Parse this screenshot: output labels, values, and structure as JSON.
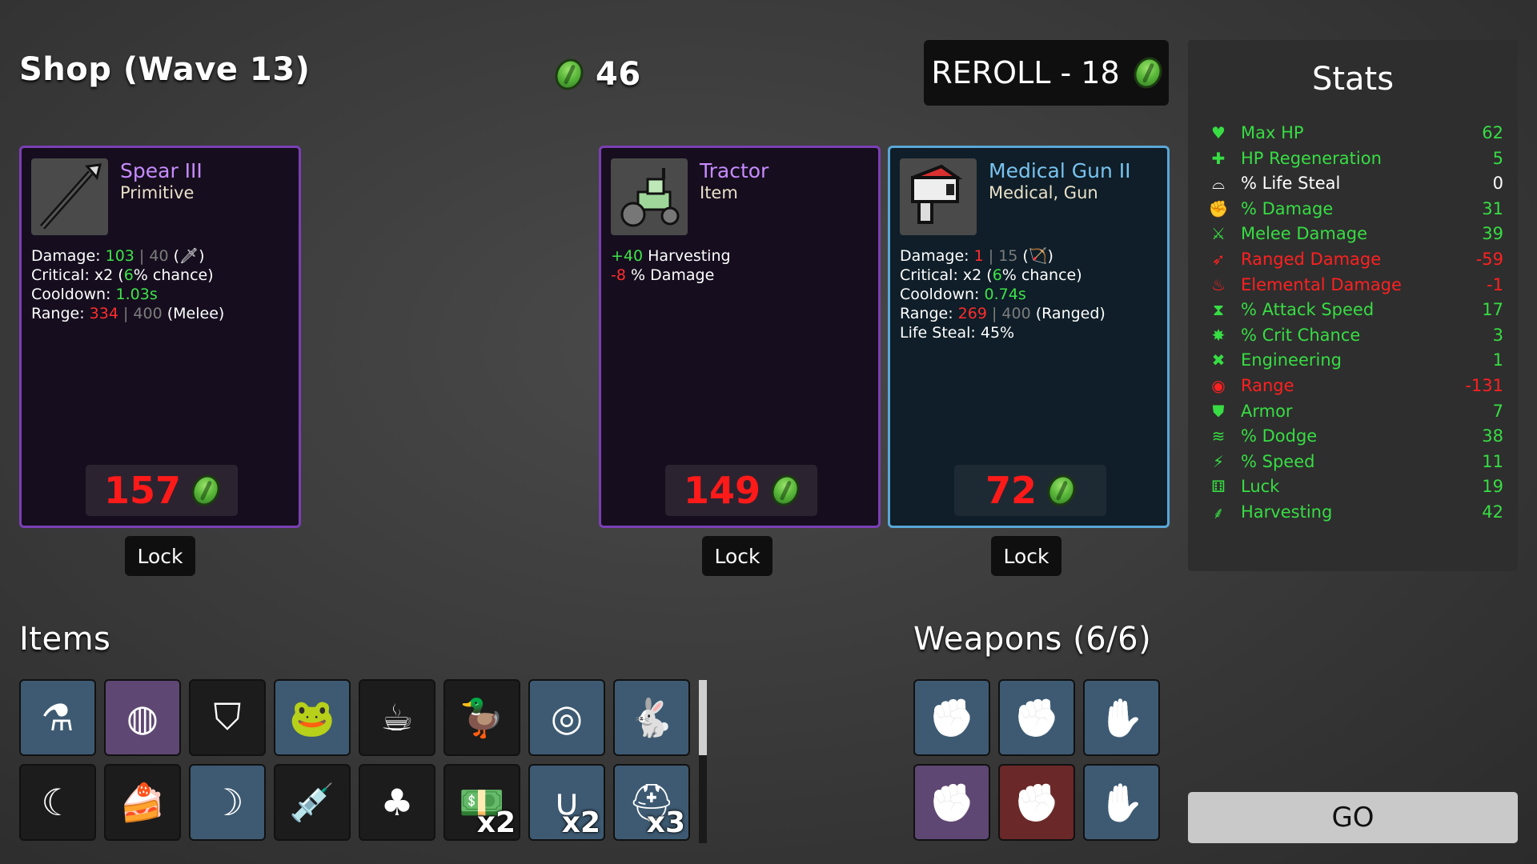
{
  "header": {
    "shop_title": "Shop (Wave 13)",
    "materials": "46",
    "reroll_label": "REROLL - 18"
  },
  "shop": [
    {
      "name": "Spear III",
      "tags": "Primitive",
      "icon": "spear-icon",
      "lines": [
        {
          "label": "Damage: ",
          "parts": [
            [
              "g",
              "103"
            ],
            [
              "grey",
              " | 40 "
            ],
            [
              "w",
              "(🗡)"
            ]
          ]
        },
        {
          "label": "Critical: ",
          "parts": [
            [
              "w",
              "x2 ("
            ],
            [
              "g",
              "6"
            ],
            [
              "w",
              "% chance)"
            ]
          ]
        },
        {
          "label": "Cooldown: ",
          "parts": [
            [
              "g",
              "1.03s"
            ]
          ]
        },
        {
          "label": "Range: ",
          "parts": [
            [
              "r",
              "334"
            ],
            [
              "grey",
              " | 400 "
            ],
            [
              "w",
              "(Melee)"
            ]
          ]
        }
      ],
      "price": "157",
      "lock": "Lock"
    },
    {
      "name": "Tractor",
      "tags": "Item",
      "icon": "tractor-icon",
      "lines": [
        {
          "label": "",
          "parts": [
            [
              "g",
              "+40"
            ],
            [
              "w",
              " Harvesting"
            ]
          ]
        },
        {
          "label": "",
          "parts": [
            [
              "r",
              "-8"
            ],
            [
              "w",
              " % Damage"
            ]
          ]
        }
      ],
      "price": "149",
      "lock": "Lock"
    },
    {
      "name": "Medical Gun II",
      "tags": "Medical, Gun",
      "icon": "medical-gun-icon",
      "lines": [
        {
          "label": "Damage: ",
          "parts": [
            [
              "r",
              "1"
            ],
            [
              "grey",
              " | 15 "
            ],
            [
              "w",
              "(🏹)"
            ]
          ]
        },
        {
          "label": "Critical: ",
          "parts": [
            [
              "w",
              "x2 ("
            ],
            [
              "g",
              "6"
            ],
            [
              "w",
              "% chance)"
            ]
          ]
        },
        {
          "label": "Cooldown: ",
          "parts": [
            [
              "g",
              "0.74s"
            ]
          ]
        },
        {
          "label": "Range: ",
          "parts": [
            [
              "r",
              "269"
            ],
            [
              "grey",
              " | 400 "
            ],
            [
              "w",
              "(Ranged)"
            ]
          ]
        },
        {
          "label": "Life Steal: ",
          "parts": [
            [
              "w",
              "45%"
            ]
          ]
        }
      ],
      "price": "72",
      "lock": "Lock"
    }
  ],
  "stats": {
    "title": "Stats",
    "rows": [
      {
        "label": "Max HP",
        "value": "62",
        "color": "green",
        "icon": "heart-icon",
        "glyph": "♥"
      },
      {
        "label": "HP Regeneration",
        "value": "5",
        "color": "green",
        "icon": "heart-plus-icon",
        "glyph": "✚"
      },
      {
        "label": "% Life Steal",
        "value": "0",
        "color": "white",
        "icon": "fangs-icon",
        "glyph": "⌓"
      },
      {
        "label": "% Damage",
        "value": "31",
        "color": "green",
        "icon": "muscle-icon",
        "glyph": "✊"
      },
      {
        "label": "Melee Damage",
        "value": "39",
        "color": "green",
        "icon": "sword-icon",
        "glyph": "⚔"
      },
      {
        "label": "Ranged Damage",
        "value": "-59",
        "color": "red",
        "icon": "bow-icon",
        "glyph": "➶"
      },
      {
        "label": "Elemental Damage",
        "value": "-1",
        "color": "red",
        "icon": "flame-icon",
        "glyph": "♨"
      },
      {
        "label": "% Attack Speed",
        "value": "17",
        "color": "green",
        "icon": "hourglass-icon",
        "glyph": "⧗"
      },
      {
        "label": "% Crit Chance",
        "value": "3",
        "color": "green",
        "icon": "crit-icon",
        "glyph": "✸"
      },
      {
        "label": "Engineering",
        "value": "1",
        "color": "green",
        "icon": "wrench-icon",
        "glyph": "✖"
      },
      {
        "label": "Range",
        "value": "-131",
        "color": "red",
        "icon": "range-icon",
        "glyph": "◉"
      },
      {
        "label": "Armor",
        "value": "7",
        "color": "green",
        "icon": "shield-icon",
        "glyph": "⛊"
      },
      {
        "label": "% Dodge",
        "value": "38",
        "color": "green",
        "icon": "dodge-icon",
        "glyph": "≋"
      },
      {
        "label": "% Speed",
        "value": "11",
        "color": "green",
        "icon": "boot-icon",
        "glyph": "⚡"
      },
      {
        "label": "Luck",
        "value": "19",
        "color": "green",
        "icon": "dice-icon",
        "glyph": "⚅"
      },
      {
        "label": "Harvesting",
        "value": "42",
        "color": "green",
        "icon": "wheat-icon",
        "glyph": "⸙"
      }
    ]
  },
  "items_section": {
    "title": "Items",
    "items": [
      {
        "icon": "potion-icon",
        "glyph": "⚗",
        "bg": "blue",
        "mult": ""
      },
      {
        "icon": "ring-icon",
        "glyph": "◍",
        "bg": "purple",
        "mult": ""
      },
      {
        "icon": "wizard-hat-icon",
        "glyph": "⛉",
        "bg": "dark",
        "mult": ""
      },
      {
        "icon": "frog-icon",
        "glyph": "🐸",
        "bg": "blue",
        "mult": ""
      },
      {
        "icon": "coffee-icon",
        "glyph": "☕",
        "bg": "dark",
        "mult": ""
      },
      {
        "icon": "duck-icon",
        "glyph": "🦆",
        "bg": "dark",
        "mult": ""
      },
      {
        "icon": "black-belt-icon",
        "glyph": "◎",
        "bg": "blue",
        "mult": ""
      },
      {
        "icon": "bunny-icon",
        "glyph": "🐇",
        "bg": "blue",
        "mult": ""
      },
      {
        "icon": "claw-icon",
        "glyph": "☾",
        "bg": "dark",
        "mult": ""
      },
      {
        "icon": "cake-icon",
        "glyph": "🍰",
        "bg": "dark",
        "mult": ""
      },
      {
        "icon": "horn-icon",
        "glyph": "☽",
        "bg": "blue",
        "mult": ""
      },
      {
        "icon": "syringe-icon",
        "glyph": "💉",
        "bg": "dark",
        "mult": ""
      },
      {
        "icon": "seed-bag-icon",
        "glyph": "♣",
        "bg": "dark",
        "mult": ""
      },
      {
        "icon": "cash-icon",
        "glyph": "💵",
        "bg": "dark",
        "mult": "x2"
      },
      {
        "icon": "sausage-icon",
        "glyph": "∪",
        "bg": "blue",
        "mult": "x2"
      },
      {
        "icon": "helmet-icon",
        "glyph": "⛑",
        "bg": "blue",
        "mult": "x3"
      }
    ]
  },
  "weapons_section": {
    "title": "Weapons (6/6)",
    "weapons": [
      {
        "icon": "fire-fist-icon",
        "glyph": "✊",
        "bg": "blue"
      },
      {
        "icon": "fist-icon",
        "glyph": "✊",
        "bg": "blue"
      },
      {
        "icon": "hand-icon",
        "glyph": "✋",
        "bg": "blue"
      },
      {
        "icon": "fist-icon",
        "glyph": "✊",
        "bg": "purple"
      },
      {
        "icon": "fist-icon",
        "glyph": "✊",
        "bg": "red"
      },
      {
        "icon": "hand-icon",
        "glyph": "✋",
        "bg": "blue"
      }
    ]
  },
  "go_label": "GO"
}
